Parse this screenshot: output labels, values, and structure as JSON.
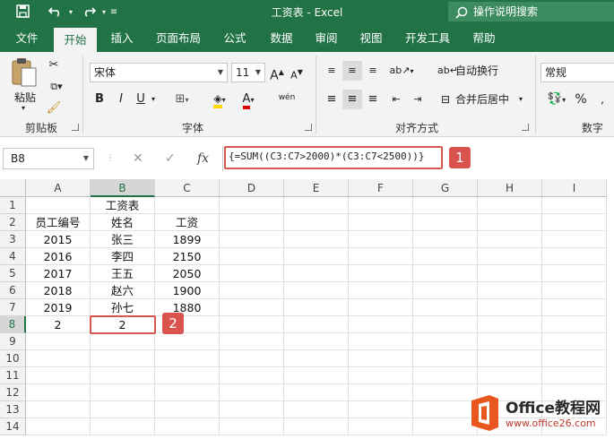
{
  "window": {
    "title": "工资表  -  Excel",
    "tell_me": "操作说明搜索"
  },
  "quick_access": {
    "save_icon": "save-icon",
    "undo_icon": "undo-icon",
    "redo_icon": "redo-icon",
    "customize_icon": "customize-icon"
  },
  "tabs": [
    "文件",
    "开始",
    "插入",
    "页面布局",
    "公式",
    "数据",
    "审阅",
    "视图",
    "开发工具",
    "帮助"
  ],
  "active_tab": "开始",
  "ribbon": {
    "clipboard": {
      "paste_label": "粘贴",
      "group_label": "剪贴板"
    },
    "font": {
      "name": "宋体",
      "size": "11",
      "group_label": "字体",
      "bold": "B",
      "italic": "I",
      "underline": "U",
      "grow": "A",
      "shrink": "A",
      "wen": "wén"
    },
    "alignment": {
      "wrap_label": "自动换行",
      "merge_label": "合并后居中",
      "group_label": "对齐方式"
    },
    "number": {
      "format": "常规",
      "percent": "%",
      "group_label": "数字"
    }
  },
  "formula_bar": {
    "name_box": "B8",
    "cancel": "✕",
    "confirm": "✓",
    "fx": "fx",
    "formula": "{=SUM((C3:C7>2000)*(C3:C7<2500))}"
  },
  "annotations": {
    "badge1": "1",
    "badge2": "2"
  },
  "columns": [
    "A",
    "B",
    "C",
    "D",
    "E",
    "F",
    "G",
    "H",
    "I"
  ],
  "rows": [
    "1",
    "2",
    "3",
    "4",
    "5",
    "6",
    "7",
    "8",
    "9",
    "10",
    "11",
    "12",
    "13",
    "14"
  ],
  "selected_cell": "B8",
  "cells": {
    "B1": "工资表",
    "A2": "员工编号",
    "B2": "姓名",
    "C2": "工资",
    "A3": "2015",
    "B3": "张三",
    "C3": "1899",
    "A4": "2016",
    "B4": "李四",
    "C4": "2150",
    "A5": "2017",
    "B5": "王五",
    "C5": "2050",
    "A6": "2018",
    "B6": "赵六",
    "C6": "1900",
    "A7": "2019",
    "B7": "孙七",
    "C7": "1880",
    "A8": "2",
    "B8": "2"
  },
  "watermark": {
    "title": "Office教程网",
    "url": "www.office26.com"
  },
  "colors": {
    "accent": "#217346",
    "annotation": "#d9534f"
  }
}
